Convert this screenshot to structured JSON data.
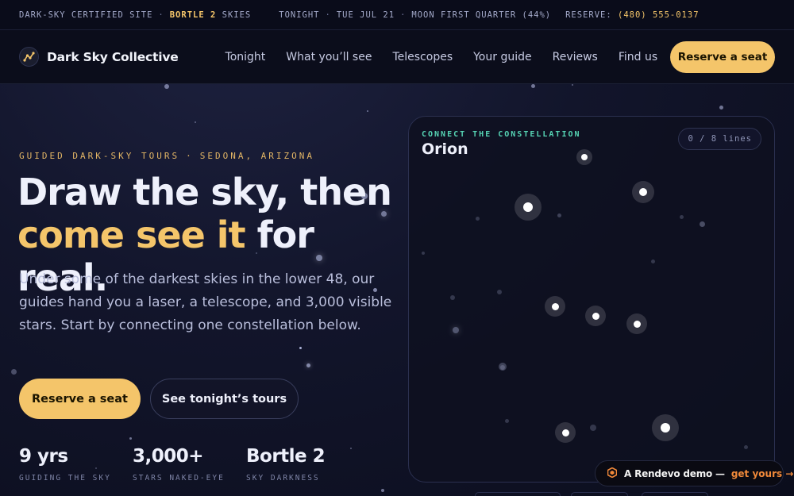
{
  "topbar": {
    "site": "DARK-SKY CERTIFIED SITE",
    "bortle_value": "BORTLE 2",
    "bortle_suffix": "SKIES",
    "tonight": "TONIGHT",
    "date": "TUE JUL 21",
    "moon": "MOON FIRST QUARTER (44%)",
    "reserve_label": "RESERVE:",
    "phone": "(480) 555-0137",
    "separator": "·"
  },
  "nav": {
    "brand": "Dark Sky Collective",
    "links": [
      "Tonight",
      "What you’ll see",
      "Telescopes",
      "Your guide",
      "Reviews",
      "Find us"
    ],
    "cta": "Reserve a seat"
  },
  "hero": {
    "eyebrow_left": "GUIDED DARK-SKY TOURS",
    "eyebrow_right": "SEDONA, ARIZONA",
    "headline_line1": "Draw the sky, then",
    "headline_gold": "come see it",
    "headline_rest": " for real.",
    "lede": "Under some of the darkest skies in the lower 48, our guides hand you a laser, a telescope, and 3,000 visible stars. Start by connecting one constellation below.",
    "primary_cta": "Reserve a seat",
    "secondary_cta": "See tonight’s tours",
    "stats": [
      {
        "value": "9 yrs",
        "label": "GUIDING THE SKY"
      },
      {
        "value": "3,000+",
        "label": "STARS NAKED-EYE"
      },
      {
        "value": "Bortle 2",
        "label": "SKY DARKNESS"
      }
    ]
  },
  "game": {
    "eyebrow": "CONNECT THE CONSTELLATION",
    "title": "Orion",
    "counter": "0 / 8 lines",
    "lines_drawn": 0,
    "lines_total": 8
  },
  "badge": {
    "text": "A Rendevo demo —",
    "link": "get yours →"
  },
  "colors": {
    "accent": "#f4c56a",
    "teal": "#56d4b4",
    "badge_link": "#f28a3a",
    "background": "#12152b"
  }
}
